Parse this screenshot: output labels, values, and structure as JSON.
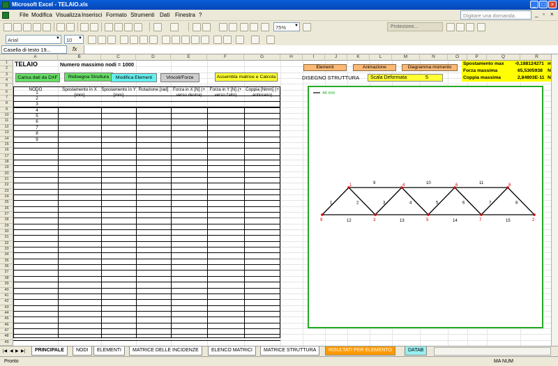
{
  "window": {
    "title": "Microsoft Excel - TELAIO.xls"
  },
  "menu": {
    "items": [
      "File",
      "Modifica",
      "Visualizza",
      "Inserisci",
      "Formato",
      "Strumenti",
      "Dati",
      "Finestra",
      "?"
    ],
    "ask_placeholder": "Digitare una domanda."
  },
  "toolbar": {
    "zoom": "75%",
    "font_name": "Arial",
    "font_size": "10",
    "protection_label": "Protezione..."
  },
  "formula_bar": {
    "name_box": "Casella di testo 19...",
    "fx": "fx",
    "content": ""
  },
  "columns": [
    "A",
    "B",
    "C",
    "D",
    "E",
    "F",
    "G",
    "H",
    "I",
    "J",
    "K",
    "L",
    "M",
    "N",
    "O",
    "P",
    "Q",
    "R"
  ],
  "rows": [
    "1",
    "2",
    "3",
    "4",
    "5",
    "6",
    "7",
    "8",
    "9",
    "10",
    "11",
    "12",
    "13",
    "14",
    "15",
    "16",
    "17",
    "18",
    "19",
    "20",
    "21",
    "22",
    "23",
    "24",
    "25",
    "26",
    "27",
    "28",
    "29",
    "30",
    "31",
    "32",
    "33",
    "34",
    "35",
    "36",
    "37",
    "38",
    "39",
    "40",
    "41",
    "42",
    "43",
    "44",
    "45",
    "46",
    "47",
    "48",
    "49"
  ],
  "sheet": {
    "title": "TELAIO",
    "max_nodes": "Numero massimo nodi = 1000",
    "buttons": {
      "carica": "Carica dati da DXF",
      "ridisegna": "Ridisegna Struttura",
      "modifica": "Modifica Element",
      "vincoli": "Vincoli/Forze",
      "assembla": "Assembla matrice e Calcola",
      "elementi": "Elementi",
      "animazione": "Animazione",
      "diagramma": "Diagramma momento"
    },
    "headers": {
      "nodo": "NODO",
      "spost_x": "Spostamento in X [mm]",
      "spost_y": "Spostamento in Y [mm]",
      "rotazione": "Rotazione [rad]",
      "forza_x": "Forza in X [N] (+ verso destra)",
      "forza_y": "Forza in Y [N] (+ verso l'alto)",
      "coppia": "Coppia [Nmm] (+ antiorario)"
    },
    "node_numbers": [
      "1",
      "2",
      "3",
      "4",
      "5",
      "6",
      "7",
      "8",
      "9"
    ],
    "disegno_label": "DISEGNO STRUTTURA",
    "scala_label": "Scala Deformata",
    "scala_value": "5",
    "stats": {
      "spost_label": "Spostamento max",
      "spost_value": "-0,188124271",
      "forza_label": "Forza massima",
      "forza_value": "65,5305938",
      "coppia_label": "Coppia massima",
      "coppia_value": "2,84803E-11",
      "unit_spost": "m",
      "unit_forza": "N",
      "unit_coppia": "N"
    },
    "scale_bar_label": "44 mm"
  },
  "truss": {
    "node_labels": [
      "1",
      "2",
      "3",
      "4",
      "5",
      "6",
      "7",
      "8",
      "9"
    ],
    "element_labels": [
      "1",
      "2",
      "3",
      "4",
      "5",
      "6",
      "7",
      "8",
      "9",
      "10",
      "11",
      "12",
      "13",
      "14",
      "15"
    ],
    "node_color": "#cc0000",
    "line_color": "#000000"
  },
  "tabs": [
    "PRINCIPALE",
    "NODI",
    "ELEMENTI",
    "MATRICE DELLE INCIDENZE",
    "ELENCO MATRICI",
    "MATRICE STRUTTURA",
    "RISULTATI PER ELEMENTO",
    "DATAB"
  ],
  "status": {
    "left": "Pronto",
    "right": "MA  NUM"
  }
}
